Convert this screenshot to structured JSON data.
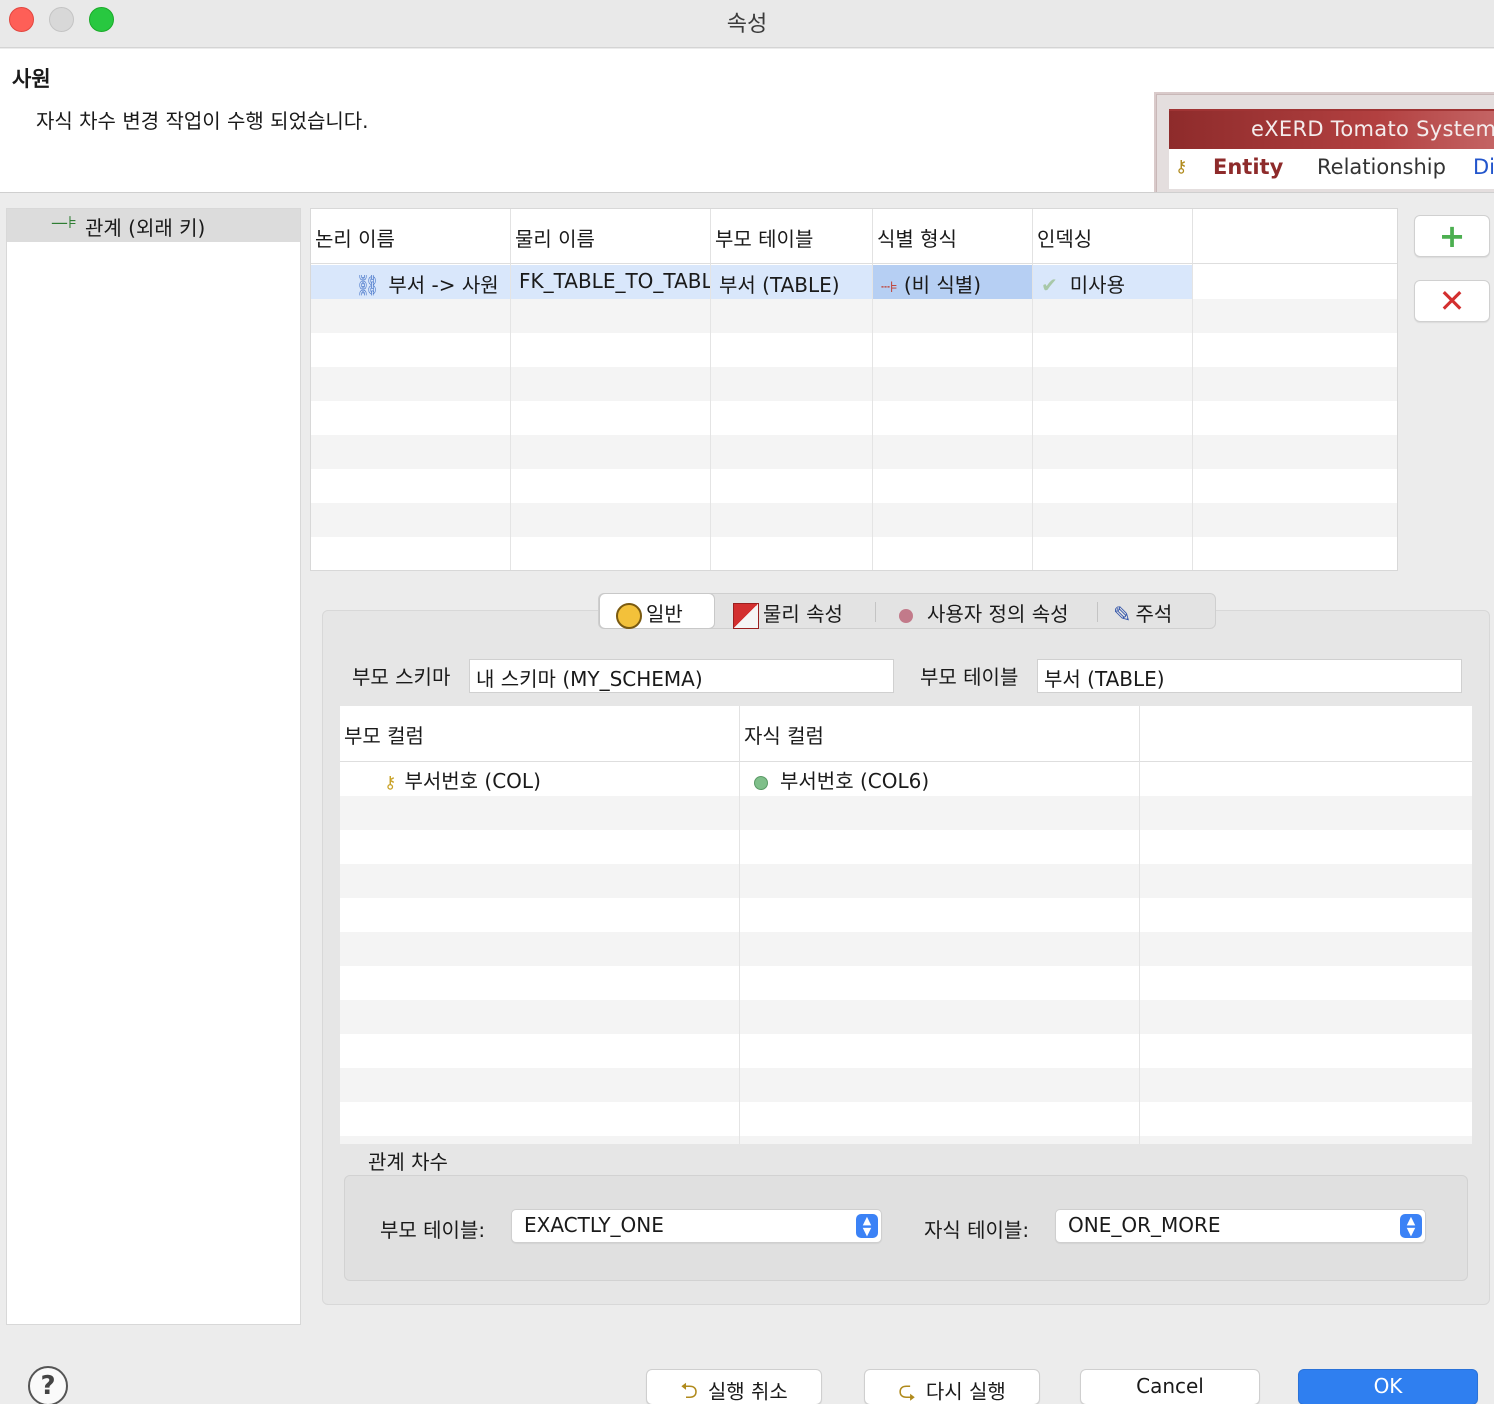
{
  "window": {
    "title": "속성"
  },
  "header": {
    "title": "사원",
    "message": "자식 차수 변경 작업이 수행 되었습니다.",
    "banner": {
      "brand": "eXERD  Tomato System",
      "tab_entity": "Entity",
      "tab_relationship": "Relationship",
      "tab_more": "Di"
    }
  },
  "tree": {
    "items": [
      {
        "label": "관계 (외래 키)",
        "icon": "foreign-key-icon"
      }
    ]
  },
  "relations": {
    "columns": [
      "논리 이름",
      "물리 이름",
      "부모 테이블",
      "식별 형식",
      "인덱싱"
    ],
    "rows": [
      {
        "logical_name": "부서 -> 사원",
        "physical_name": "FK_TABLE_TO_TABLE",
        "parent_table": "부서 (TABLE)",
        "identifying": "(비 식별)",
        "indexing": "미사용"
      }
    ]
  },
  "actions": {
    "add": "+",
    "delete": "✕"
  },
  "tabs": [
    {
      "label": "일반",
      "icon": "general-icon",
      "active": true
    },
    {
      "label": "물리 속성",
      "icon": "physical-icon",
      "active": false
    },
    {
      "label": "사용자 정의 속성",
      "icon": "custom-property-icon",
      "active": false
    },
    {
      "label": "주석",
      "icon": "comment-icon",
      "active": false
    }
  ],
  "general": {
    "parent_schema_label": "부모 스키마",
    "parent_schema_value": "내 스키마 (MY_SCHEMA)",
    "parent_table_label": "부모 테이블",
    "parent_table_value": "부서 (TABLE)",
    "columns_header": [
      "부모 컬럼",
      "자식 컬럼"
    ],
    "column_rows": [
      {
        "parent": "부서번호 (COL)",
        "child": "부서번호 (COL6)"
      }
    ],
    "cardinality_title": "관계 차수",
    "parent_card_label": "부모 테이블:",
    "parent_card_value": "EXACTLY_ONE",
    "child_card_label": "자식 테이블:",
    "child_card_value": "ONE_OR_MORE"
  },
  "footer": {
    "help": "?",
    "undo": "실행 취소",
    "redo": "다시 실행",
    "cancel": "Cancel",
    "ok": "OK"
  },
  "colors": {
    "accent": "#2f7ff0",
    "selection": "#d9e7fb",
    "banner": "#8e2b2b"
  }
}
